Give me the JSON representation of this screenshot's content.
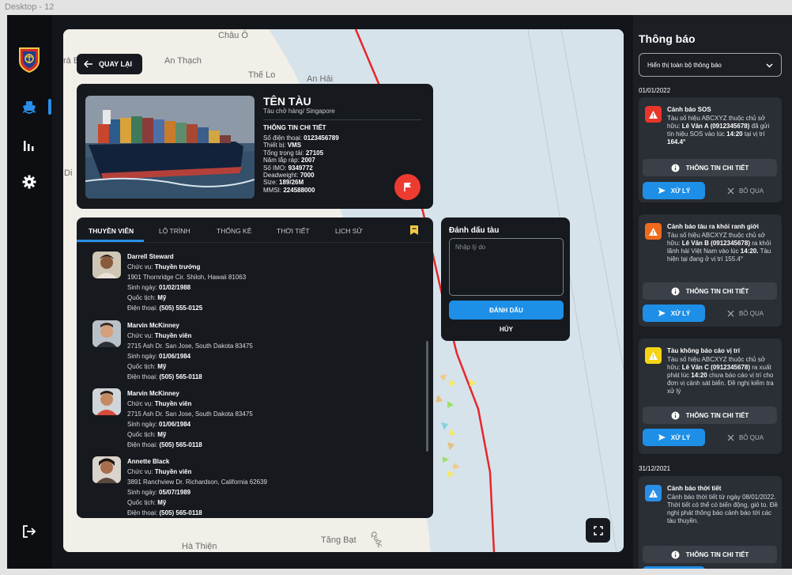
{
  "frame_label": "Desktop - 12",
  "map": {
    "places": [
      "Châu Ô",
      "rà Bồng",
      "An Thạch",
      "Thế Lo",
      "An Hải",
      "Di",
      "Hà Thiện",
      "Tăng Bạt",
      "Quốc"
    ]
  },
  "back_label": "QUAY LẠI",
  "ship": {
    "name": "TÊN TÀU",
    "subtitle": "Tàu chở hàng/ Singapore",
    "detail_title": "THÔNG TIN CHI TIẾT",
    "fields": [
      {
        "label": "Số điện thoại:",
        "value": "0123456789"
      },
      {
        "label": "Thiết bị:",
        "value": "VMS"
      },
      {
        "label": "Tổng trọng tải:",
        "value": "27105"
      },
      {
        "label": "Năm lắp ráp:",
        "value": "2007"
      },
      {
        "label": "Số IMO:",
        "value": "9349772"
      },
      {
        "label": "Deadweight:",
        "value": "7000"
      },
      {
        "label": "Size:",
        "value": "189/26M"
      },
      {
        "label": "MMSI:",
        "value": "224588000"
      }
    ]
  },
  "tabs": [
    "THUYỀN VIÊN",
    "LỘ TRÌNH",
    "THỐNG KÊ",
    "THỜI TIẾT",
    "LỊCH SỬ"
  ],
  "crew": [
    {
      "name": "Darrell Steward",
      "role_label": "Chức vụ:",
      "role": "Thuyền trưởng",
      "address": "1901 Thornridge Cir. Shiloh, Hawaii 81063",
      "dob_label": "Sinh ngày:",
      "dob": "01/02/1988",
      "nat_label": "Quốc tịch:",
      "nat": "Mỹ",
      "phone_label": "Điện thoại:",
      "phone": "(505) 555-0125"
    },
    {
      "name": "Marvin McKinney",
      "role_label": "Chức vụ:",
      "role": "Thuyền viên",
      "address": "2715 Ash Dr. San Jose, South Dakota 83475",
      "dob_label": "Sinh ngày:",
      "dob": "01/06/1984",
      "nat_label": "Quốc tịch:",
      "nat": "Mỹ",
      "phone_label": "Điện thoại:",
      "phone": "(505) 565-0118"
    },
    {
      "name": "Marvin McKinney",
      "role_label": "Chức vụ:",
      "role": "Thuyền viên",
      "address": "2715 Ash Dr. San Jose, South Dakota 83475",
      "dob_label": "Sinh ngày:",
      "dob": "01/06/1984",
      "nat_label": "Quốc tịch:",
      "nat": "Mỹ",
      "phone_label": "Điện thoại:",
      "phone": "(505) 565-0118"
    },
    {
      "name": "Annette Black",
      "role_label": "Chức vụ:",
      "role": "Thuyền viên",
      "address": "3891 Ranchview Dr. Richardson, California 62639",
      "dob_label": "Sinh ngày:",
      "dob": "05/07/1989",
      "nat_label": "Quốc tịch:",
      "nat": "Mỹ",
      "phone_label": "Điện thoại:",
      "phone": "(505) 565-0118"
    }
  ],
  "mark": {
    "title": "Đánh dấu tàu",
    "placeholder": "Nhập lý do",
    "submit": "ĐÁNH DẤU",
    "cancel": "HỦY"
  },
  "notifications": {
    "title": "Thông báo",
    "filter": "Hiển thị toàn bộ thông báo",
    "detail_label": "THÔNG TIN CHI TIẾT",
    "handle_label": "XỬ LÝ",
    "skip_label": "BỎ QUA",
    "groups": [
      {
        "date": "01/01/2022"
      },
      {
        "date": "31/12/2021"
      }
    ],
    "items": [
      {
        "title": "Cảnh báo SOS",
        "color": "#e8362b",
        "body": [
          "Tàu số hiệu ABCXYZ thuộc chủ sở hữu: ",
          "Lê Văn A (0912345678)",
          " đã gửi tín hiệu SOS vào lúc ",
          "14:20",
          " tại vị trí ",
          "164.4°"
        ]
      },
      {
        "title": "Cảnh báo tàu ra khỏi ranh giới",
        "color": "#f06a1d",
        "body": [
          "Tàu số hiệu ABCXYZ thuộc chủ sở hữu: ",
          "Lê Văn B (0912345678)",
          " ra khỏi lãnh hải Việt Nam vào lúc ",
          "14:20.",
          " Tàu hiện tại đang ở vị trí 155.4°"
        ]
      },
      {
        "title": "Tàu không báo cáo vị trí",
        "color": "#f5d414",
        "body": [
          "Tàu số hiệu ABCXYZ thuộc chủ sở hữu: ",
          "Lê Văn C (0912345678)",
          " ra xuất phát lúc ",
          "14:20",
          " chưa báo cáo vị trí cho đơn vị cảnh sát biển. Đề nghị kiểm tra xử lý"
        ]
      },
      {
        "title": "Cảnh báo thời tiết",
        "color": "#2a8ee8",
        "body": [
          "Cảnh báo thời tiết từ ngày 08/01/2022. Thời tiết có thể có biến động, gió to. Đề nghị phát thông báo cảnh báo tới các tàu thuyền."
        ]
      }
    ]
  }
}
